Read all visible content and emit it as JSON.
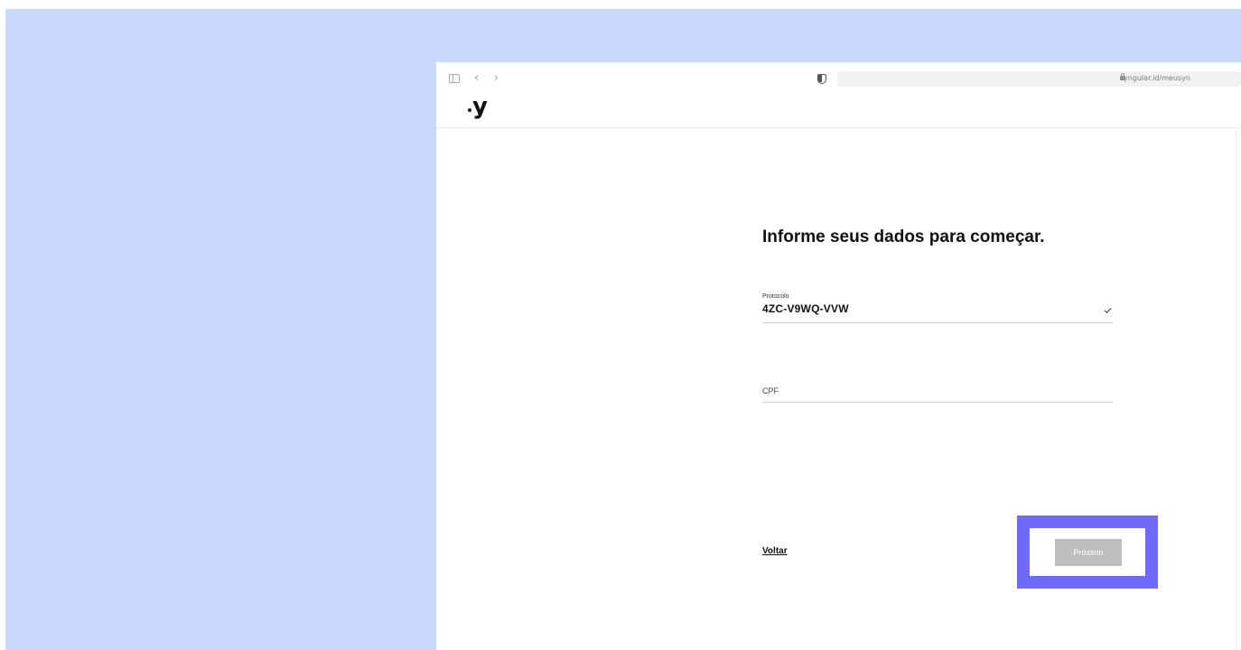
{
  "browser": {
    "url": "syngular.id/meusyn",
    "back_glyph": "‹",
    "forward_glyph": "›"
  },
  "header": {
    "logo_text": "y"
  },
  "form": {
    "heading": "Informe seus dados para começar.",
    "protocolo": {
      "label": "Protocolo",
      "value": "4ZC-V9WQ-VVW"
    },
    "cpf": {
      "placeholder": "CPF"
    },
    "back_label": "Voltar",
    "next_label": "Próximo"
  },
  "colors": {
    "background": "#c8d9fd",
    "highlight": "#6f6af8",
    "next_button_disabled": "#bdbdbd"
  },
  "icons": [
    "sidebar-icon",
    "back-icon",
    "forward-icon",
    "shield-icon",
    "lock-icon",
    "check-icon"
  ]
}
